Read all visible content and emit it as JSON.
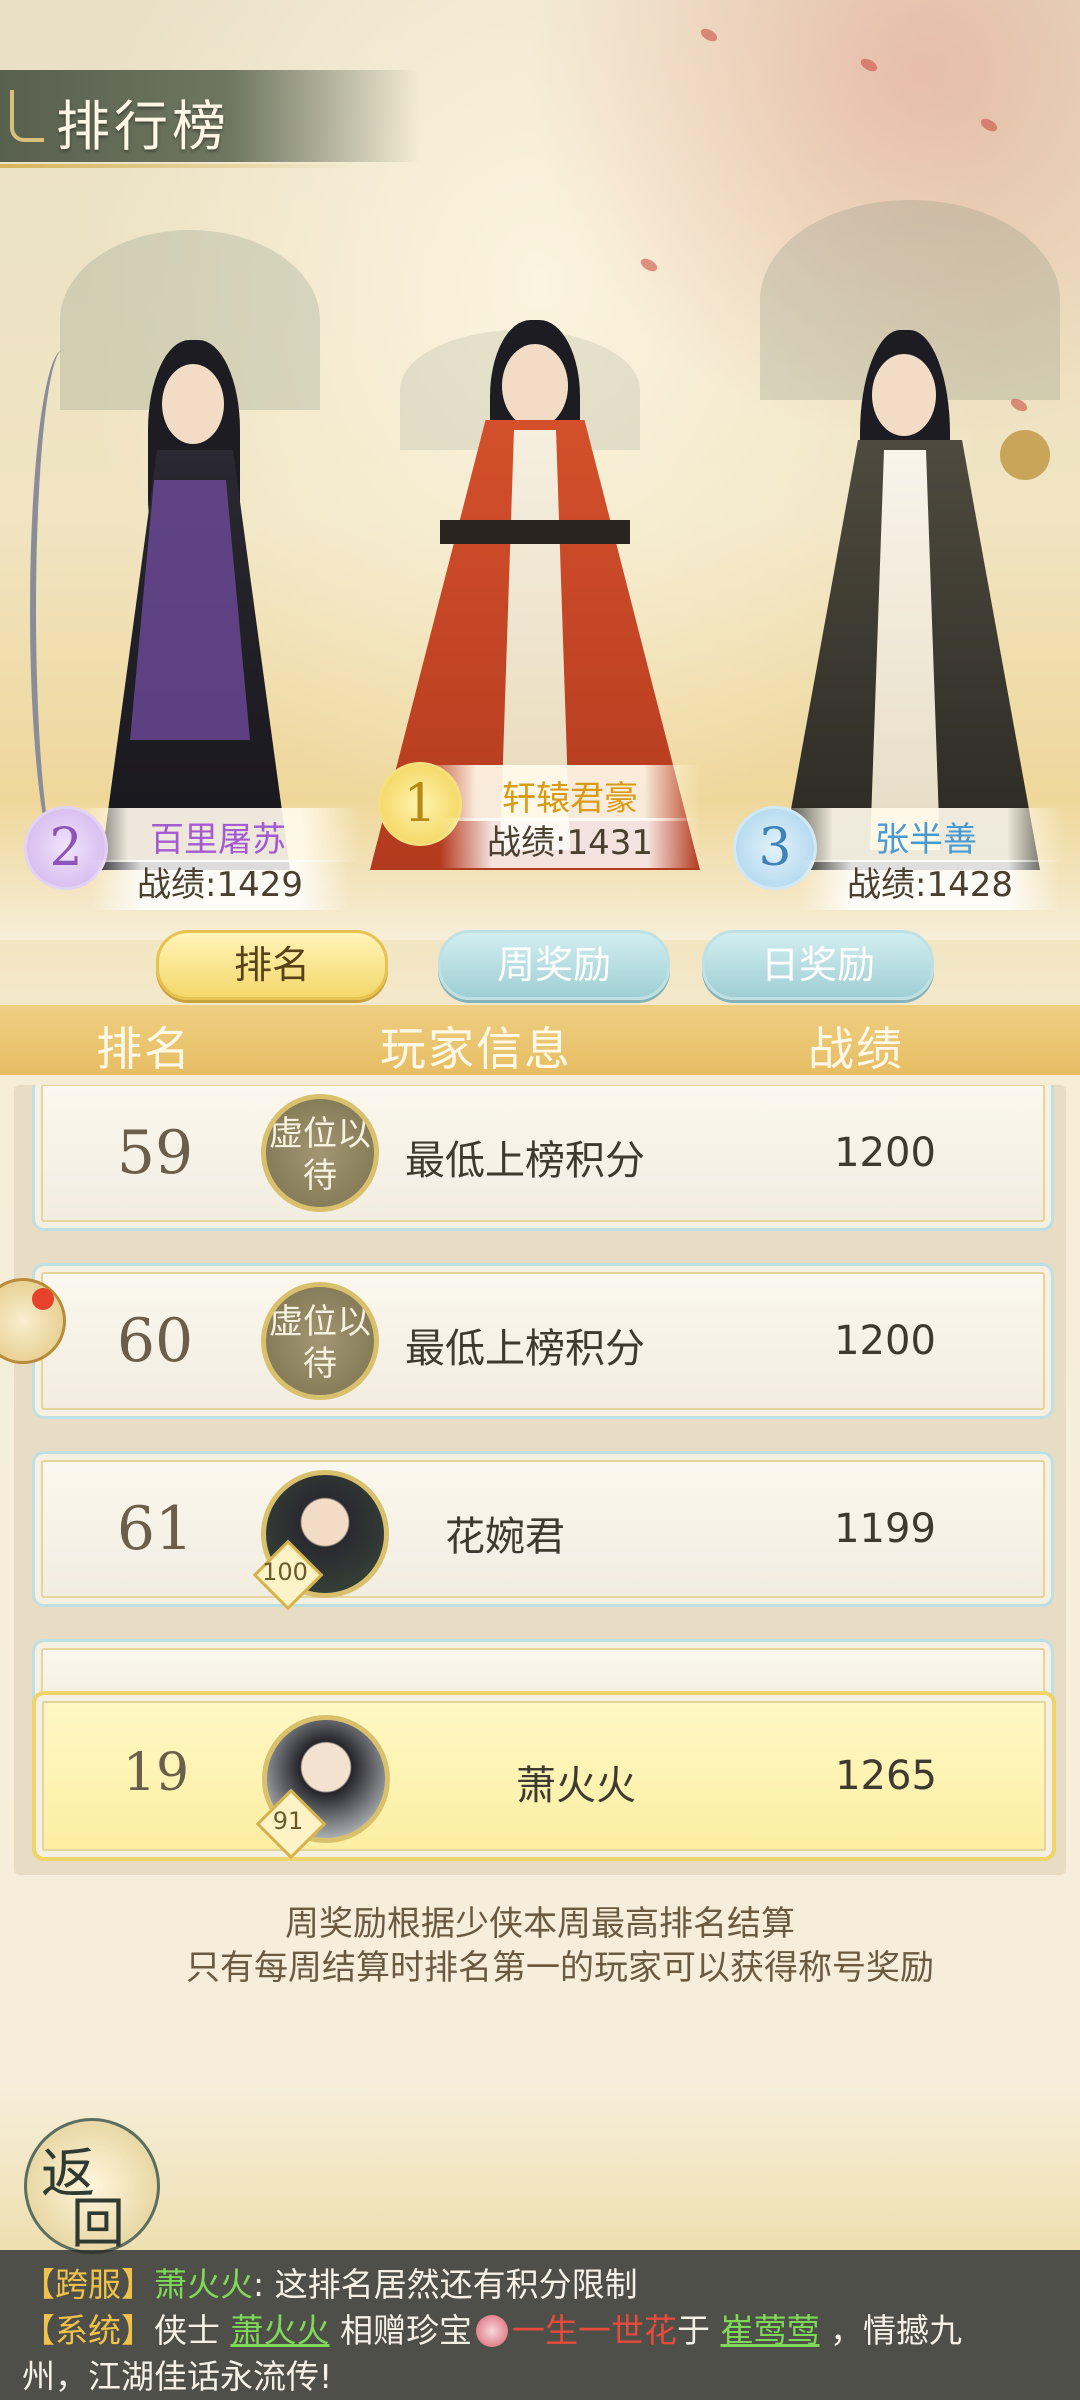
{
  "header": {
    "title": "排行榜"
  },
  "podium": [
    {
      "rank": "1",
      "name": "轩辕君豪",
      "score_label": "战绩:1431"
    },
    {
      "rank": "2",
      "name": "百里屠苏",
      "score_label": "战绩:1429"
    },
    {
      "rank": "3",
      "name": "张半善",
      "score_label": "战绩:1428"
    }
  ],
  "tabs": [
    {
      "label": "排名",
      "active": true
    },
    {
      "label": "周奖励",
      "active": false
    },
    {
      "label": "日奖励",
      "active": false
    }
  ],
  "list_header": {
    "rank": "排名",
    "info": "玩家信息",
    "score": "战绩"
  },
  "rows": [
    {
      "rank": "59",
      "avatar_text": "虚位以待",
      "name": "最低上榜积分",
      "score": "1200"
    },
    {
      "rank": "60",
      "avatar_text": "虚位以待",
      "name": "最低上榜积分",
      "score": "1200"
    },
    {
      "rank": "61",
      "name": "花婉君",
      "score": "1199",
      "level": "100"
    }
  ],
  "my_row": {
    "rank": "19",
    "name": "萧火火",
    "score": "1265",
    "level": "91"
  },
  "notes": [
    "周奖励根据少侠本周最高排名结算",
    "只有每周结算时排名第一的玩家可以获得称号奖励"
  ],
  "return_button": {
    "char1": "返",
    "char2": "回"
  },
  "chat": {
    "line1": {
      "tag": "【跨服】",
      "speaker": "萧火火",
      "message": ": 这排名居然还有积分限制"
    },
    "line2": {
      "tag": "【系统】",
      "p1": "侠士 ",
      "giver": "萧火火",
      "p2": " 相赠珍宝",
      "item": "一生一世花",
      "p3": "于 ",
      "receiver": "崔莺莺",
      "p4": " ，情撼九"
    },
    "line3": "州，江湖佳话永流传!"
  },
  "colors": {
    "rank1_name": "#d99a14",
    "rank2_name": "#a45ad0",
    "rank3_name": "#4a9ad0",
    "tab_active": "#f5d86c",
    "tab_inactive": "#9fcfd4",
    "header_bar": "#e7bd63"
  }
}
